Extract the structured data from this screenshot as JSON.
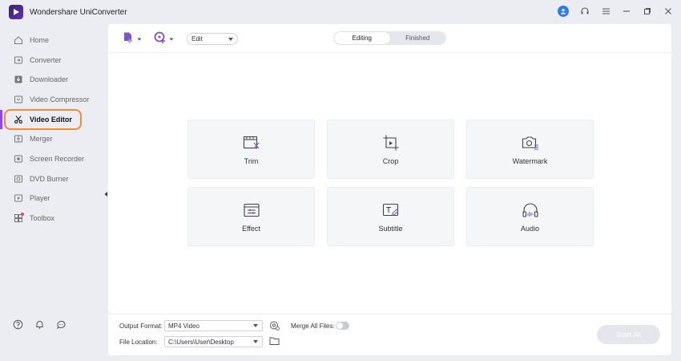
{
  "app": {
    "title": "Wondershare UniConverter"
  },
  "sidebar": {
    "items": [
      {
        "label": "Home",
        "icon": "home-icon"
      },
      {
        "label": "Converter",
        "icon": "converter-icon"
      },
      {
        "label": "Downloader",
        "icon": "download-icon"
      },
      {
        "label": "Video Compressor",
        "icon": "compress-icon"
      },
      {
        "label": "Video Editor",
        "icon": "scissors-icon",
        "active": true
      },
      {
        "label": "Merger",
        "icon": "merge-icon"
      },
      {
        "label": "Screen Recorder",
        "icon": "record-icon"
      },
      {
        "label": "DVD Burner",
        "icon": "disc-icon"
      },
      {
        "label": "Player",
        "icon": "play-icon"
      },
      {
        "label": "Toolbox",
        "icon": "toolbox-icon"
      }
    ],
    "highlight_color": "#f08a3c",
    "accent_color": "#8e44ff"
  },
  "toolbar": {
    "edit_select": "Edit",
    "tabs": {
      "editing": "Editing",
      "finished": "Finished"
    }
  },
  "tools": [
    {
      "label": "Trim",
      "icon": "trim-icon"
    },
    {
      "label": "Crop",
      "icon": "crop-icon"
    },
    {
      "label": "Watermark",
      "icon": "watermark-icon"
    },
    {
      "label": "Effect",
      "icon": "effect-icon"
    },
    {
      "label": "Subtitle",
      "icon": "subtitle-icon"
    },
    {
      "label": "Audio",
      "icon": "audio-icon"
    }
  ],
  "bottom": {
    "output_format_label": "Output Format:",
    "output_format_value": "MP4 Video",
    "merge_label": "Merge All Files:",
    "file_location_label": "File Location:",
    "file_location_value": "C:\\Users\\User\\Desktop",
    "start_all": "Start All"
  }
}
